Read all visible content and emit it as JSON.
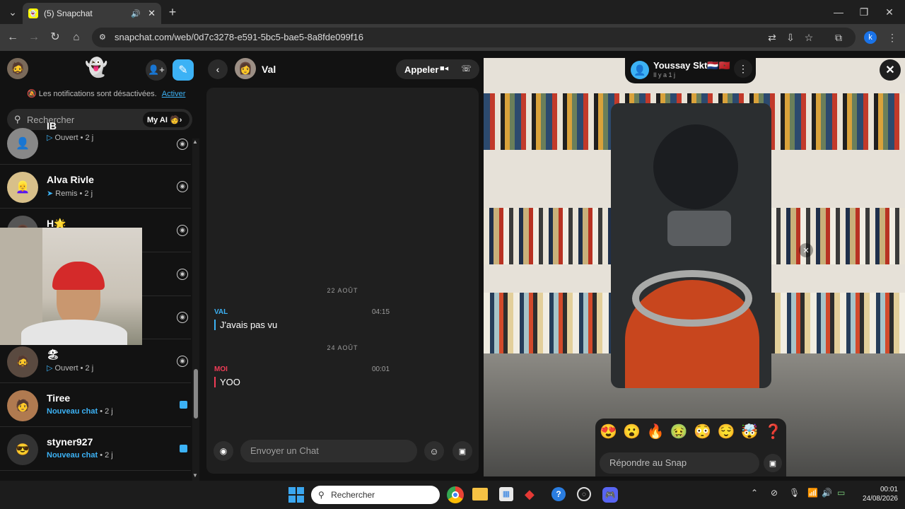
{
  "browser": {
    "tab_title": "(5) Snapchat",
    "url": "snapchat.com/web/0d7c3278-e591-5bc5-bae5-8a8fde099f16",
    "profile_initial": "k"
  },
  "sidebar": {
    "notif_text": "Les notifications sont désactivées.",
    "notif_action": "Activer",
    "search_placeholder": "Rechercher",
    "myai_label": "My AI",
    "items": [
      {
        "name": "IB",
        "status": "Ouvert",
        "time": "2 j",
        "status_color": "#9e9e9e"
      },
      {
        "name": "Alva Rivle",
        "status": "Remis",
        "time": "2 j",
        "status_color": "#9e9e9e"
      },
      {
        "name": "H🌟",
        "status": "",
        "time": "",
        "status_color": "#9e9e9e"
      },
      {
        "name": "",
        "status": "",
        "time": "",
        "status_color": "#9e9e9e"
      },
      {
        "name": "",
        "status": "",
        "time": "",
        "status_color": "#9e9e9e"
      },
      {
        "name": "🏖",
        "status": "Ouvert",
        "time": "2 j",
        "status_color": "#9e9e9e"
      },
      {
        "name": "Tiree",
        "status": "Nouveau chat",
        "time": "2 j",
        "status_color": "#3cb2f5"
      },
      {
        "name": "styner927",
        "status": "Nouveau chat",
        "time": "2 j",
        "status_color": "#3cb2f5"
      }
    ]
  },
  "chat": {
    "contact_name": "Val",
    "call_label": "Appeler",
    "messages": [
      {
        "date": "22 AOÛT",
        "sender": "VAL",
        "time": "04:15",
        "text": "J'avais pas vu"
      },
      {
        "date": "24 AOÛT",
        "sender": "MOI",
        "time": "00:01",
        "text": "YOO"
      }
    ],
    "input_placeholder": "Envoyer un Chat"
  },
  "snap": {
    "sender_name": "Youssay Skt🇳🇱🇲🇦",
    "sender_time": "Il y a 1 j",
    "reply_placeholder": "Répondre au Snap",
    "reactions": [
      "😍",
      "😮",
      "🔥",
      "🤢",
      "😳",
      "😌",
      "🤯",
      "❓"
    ]
  },
  "taskbar": {
    "search_placeholder": "Rechercher",
    "time": "00:01",
    "date": "24/08/2026"
  }
}
